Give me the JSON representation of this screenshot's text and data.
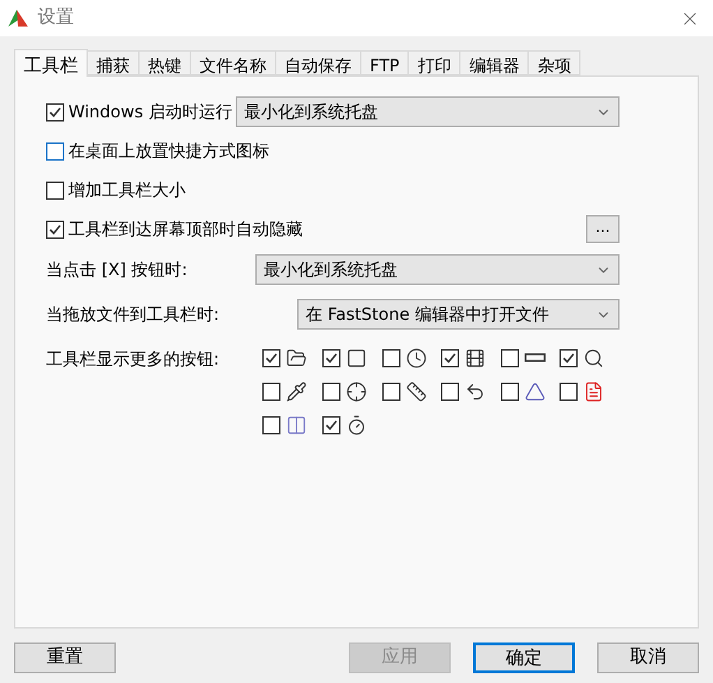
{
  "window": {
    "title": "设置"
  },
  "tabs": [
    {
      "label": "工具栏",
      "selected": true
    },
    {
      "label": "捕获",
      "selected": false
    },
    {
      "label": "热键",
      "selected": false
    },
    {
      "label": "文件名称",
      "selected": false
    },
    {
      "label": "自动保存",
      "selected": false
    },
    {
      "label": "FTP",
      "selected": false
    },
    {
      "label": "打印",
      "selected": false
    },
    {
      "label": "编辑器",
      "selected": false
    },
    {
      "label": "杂项",
      "selected": false
    }
  ],
  "options": [
    {
      "kind": "check_select",
      "label": "Windows 启动时运行",
      "checked": true,
      "value": "最小化到系统托盘"
    },
    {
      "kind": "check",
      "label": "在桌面上放置快捷方式图标",
      "checked": false,
      "focused": true
    },
    {
      "kind": "check",
      "label": "增加工具栏大小",
      "checked": false
    },
    {
      "kind": "check_more",
      "label": "工具栏到达屏幕顶部时自动隐藏",
      "checked": true,
      "button": "..."
    },
    {
      "kind": "select",
      "label": "当点击 [X] 按钮时:",
      "value": "最小化到系统托盘"
    },
    {
      "kind": "select",
      "label": "当拖放文件到工具栏时:",
      "value": "在 FastStone 编辑器中打开文件"
    }
  ],
  "more_buttons": {
    "label": "工具栏显示更多的按钮:",
    "items": [
      {
        "checked": true
      },
      {
        "checked": true
      },
      {
        "checked": false
      },
      {
        "checked": true
      },
      {
        "checked": false
      },
      {
        "checked": true
      },
      {
        "checked": false
      },
      {
        "checked": false
      },
      {
        "checked": false
      },
      {
        "checked": false
      },
      {
        "checked": false
      },
      {
        "checked": false
      },
      {
        "checked": false
      },
      {
        "checked": true
      }
    ]
  },
  "buttons": [
    {
      "label": "重置",
      "disabled": false,
      "default": false
    },
    {
      "label": "应用",
      "disabled": true,
      "default": false
    },
    {
      "label": "确定",
      "disabled": false,
      "default": true
    },
    {
      "label": "取消",
      "disabled": false,
      "default": false
    }
  ]
}
